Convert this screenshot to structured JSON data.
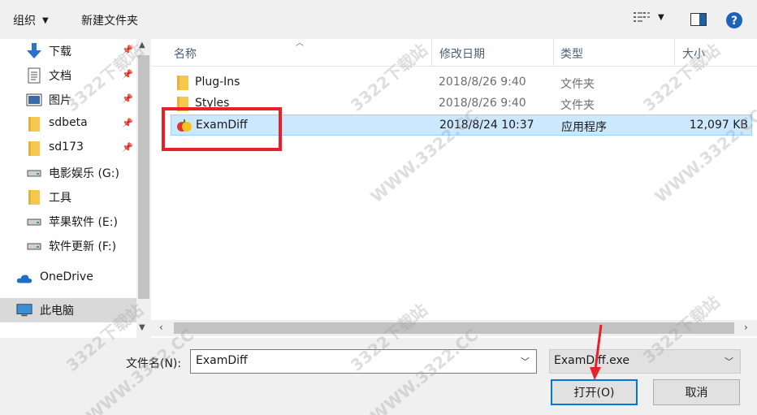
{
  "toolbar": {
    "organize_label": "组织",
    "new_folder_label": "新建文件夹"
  },
  "sidebar": {
    "items": [
      {
        "label": "下载",
        "icon": "download-arrow-icon",
        "pinned": true
      },
      {
        "label": "文档",
        "icon": "document-icon",
        "pinned": true
      },
      {
        "label": "图片",
        "icon": "pictures-icon",
        "pinned": true
      },
      {
        "label": "sdbeta",
        "icon": "folder-icon",
        "pinned": true
      },
      {
        "label": "sd173",
        "icon": "folder-icon",
        "pinned": true
      },
      {
        "label": "电影娱乐 (G:)",
        "icon": "drive-icon",
        "pinned": false
      },
      {
        "label": "工具",
        "icon": "folder-icon",
        "pinned": false
      },
      {
        "label": "苹果软件 (E:)",
        "icon": "drive-icon",
        "pinned": false
      },
      {
        "label": "软件更新 (F:)",
        "icon": "drive-icon",
        "pinned": false
      },
      {
        "label": "OneDrive",
        "icon": "cloud-icon",
        "pinned": false
      },
      {
        "label": "此电脑",
        "icon": "computer-icon",
        "pinned": false,
        "selected": true
      }
    ]
  },
  "columns": {
    "name": "名称",
    "date": "修改日期",
    "type": "类型",
    "size": "大小"
  },
  "files": [
    {
      "name": "Plug-Ins",
      "date": "2018/8/26 9:40",
      "type": "文件夹",
      "size": "",
      "icon": "folder-icon"
    },
    {
      "name": "Styles",
      "date": "2018/8/26 9:40",
      "type": "文件夹",
      "size": "",
      "icon": "folder-icon"
    },
    {
      "name": "ExamDiff",
      "date": "2018/8/24 10:37",
      "type": "应用程序",
      "size": "12,097 KB",
      "icon": "examdiff-app-icon",
      "selected": true
    }
  ],
  "bottom": {
    "filename_label": "文件名(N):",
    "filename_value": "ExamDiff",
    "filter_value": "ExamDiff.exe",
    "open_label": "打开(O)",
    "cancel_label": "取消"
  },
  "watermark": {
    "text": "3322下载站",
    "url_text": "WWW.3322.CC"
  },
  "colors": {
    "highlight_box": "#e8202a",
    "selection_bg": "#cce8ff",
    "accent": "#0078d7"
  }
}
